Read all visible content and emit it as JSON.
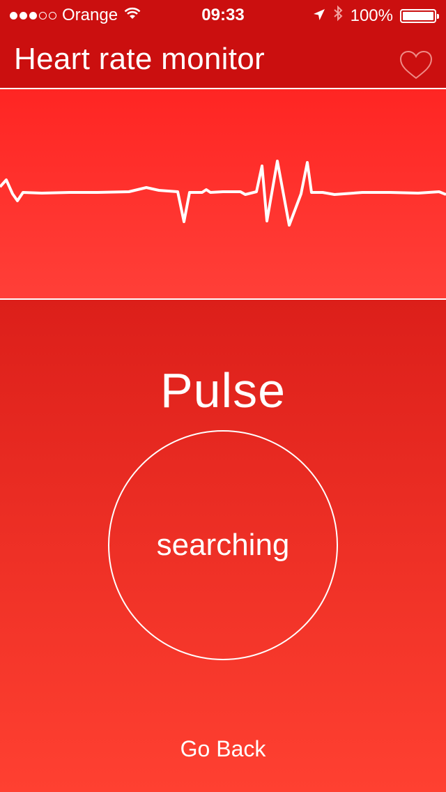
{
  "status_bar": {
    "signal_bars_filled": 3,
    "signal_bars_total": 5,
    "carrier": "Orange",
    "time": "09:33",
    "battery": "100%",
    "battery_level": 1.0,
    "icons": [
      "wifi-icon",
      "location-arrow-icon",
      "bluetooth-icon",
      "battery-icon"
    ]
  },
  "nav": {
    "title": "Heart rate monitor",
    "heart_icon": "heart-outline-icon"
  },
  "main": {
    "title": "Pulse",
    "status": "searching",
    "back_label": "Go Back"
  },
  "colors": {
    "bar_red": "#cb0f0f",
    "wave_top": "#ff2523",
    "wave_bottom": "#ff3f38",
    "main_top": "#dc1f1a",
    "main_bottom": "#ff4031",
    "foreground": "#ffffff"
  }
}
